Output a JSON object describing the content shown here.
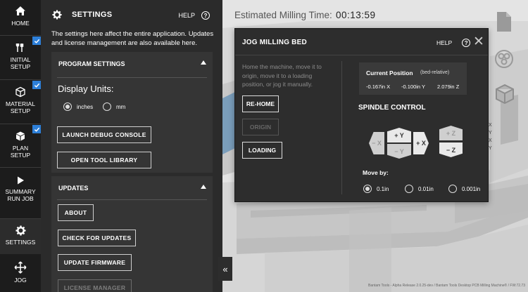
{
  "nav": {
    "items": [
      {
        "label": "HOME",
        "icon": "home-icon"
      },
      {
        "label": "INITIAL SETUP",
        "icon": "wrench-icon",
        "checked": true
      },
      {
        "label": "MATERIAL SETUP",
        "icon": "cube-icon",
        "checked": true
      },
      {
        "label": "PLAN SETUP",
        "icon": "box-icon",
        "checked": true
      },
      {
        "label": "SUMMARY RUN JOB",
        "icon": "play-icon"
      },
      {
        "label": "SETTINGS",
        "icon": "gear-icon",
        "active": true
      },
      {
        "label": "JOG",
        "icon": "move-icon"
      }
    ],
    "initial_setup_line1": "INITIAL",
    "initial_setup_line2": "SETUP",
    "material_setup_line1": "MATERIAL",
    "material_setup_line2": "SETUP",
    "plan_setup_line1": "PLAN",
    "plan_setup_line2": "SETUP",
    "summary_line1": "SUMMARY",
    "summary_line2": "RUN JOB"
  },
  "settings": {
    "title": "SETTINGS",
    "help": "HELP",
    "description": "The settings here affect the entire application. Updates and license management are also available here.",
    "program_settings": {
      "header": "PROGRAM SETTINGS",
      "display_units_label": "Display Units:",
      "units": [
        {
          "label": "inches",
          "selected": true
        },
        {
          "label": "mm",
          "selected": false
        }
      ],
      "launch_debug": "LAUNCH DEBUG CONSOLE",
      "open_tool_library": "OPEN TOOL LIBRARY"
    },
    "updates": {
      "header": "UPDATES",
      "about": "ABOUT",
      "check_updates": "CHECK FOR UPDATES",
      "update_firmware": "UPDATE FIRMWARE",
      "license_manager": "LICENSE MANAGER"
    }
  },
  "scene": {
    "estimated_label": "Estimated Milling Time:",
    "estimated_time": "00:13:59",
    "collapse_icon": "«",
    "footer": "Bantam Tools - Alpha Release 2.0.25-dev / Bantam Tools Desktop PCB Milling Machine® / FW:72.73",
    "axis_labels": [
      "X",
      "Y",
      "X",
      "Y"
    ]
  },
  "jog": {
    "title": "JOG MILLING BED",
    "help": "HELP",
    "close": "✕",
    "description": "Home the machine, move it to origin, move it to a loading position, or jog it manually.",
    "rehome": "RE-HOME",
    "origin": "ORIGIN",
    "loading": "LOADING",
    "position_title": "Current Position",
    "position_sub": "(bed-relative)",
    "pos_x": "-0.167in X",
    "pos_y": "-0.100in Y",
    "pos_z": "2.079in Z",
    "spindle_control": "SPINDLE CONTROL",
    "minus_x": "− X",
    "plus_y": "+ Y",
    "minus_y": "− Y",
    "plus_x": "+ X",
    "plus_z": "+ Z",
    "minus_z": "− Z",
    "move_by": "Move by:",
    "steps": [
      {
        "label": "0.1in",
        "selected": true
      },
      {
        "label": "0.01in",
        "selected": false
      },
      {
        "label": "0.001in",
        "selected": false
      }
    ]
  },
  "colors": {
    "nav_bg": "#1c1c1c",
    "panel_bg": "#2b2b2b",
    "card_bg": "#353535",
    "check_blue": "#2d7fd8",
    "modal_bg": "#2d2d2d"
  }
}
